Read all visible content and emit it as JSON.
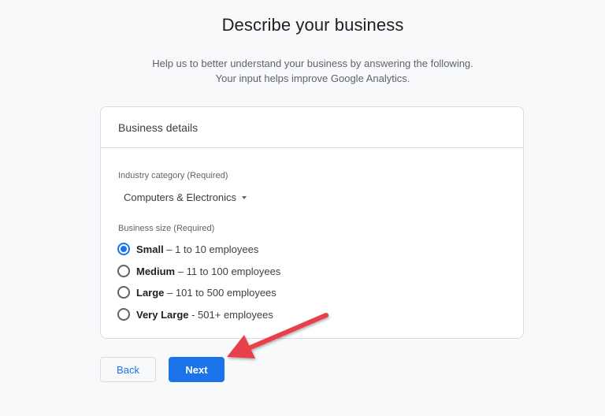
{
  "page": {
    "title": "Describe your business",
    "subtitle_line1": "Help us to better understand your business by answering the following.",
    "subtitle_line2": "Your input helps improve Google Analytics."
  },
  "card": {
    "header": "Business details",
    "industry": {
      "label": "Industry category (Required)",
      "selected": "Computers & Electronics"
    },
    "size": {
      "label": "Business size (Required)",
      "options": [
        {
          "name": "Small",
          "detail": " – 1 to 10 employees",
          "checked": true
        },
        {
          "name": "Medium",
          "detail": " – 11 to 100 employees",
          "checked": false
        },
        {
          "name": "Large",
          "detail": " – 101 to 500 employees",
          "checked": false
        },
        {
          "name": "Very Large",
          "detail": " - 501+ employees",
          "checked": false
        }
      ]
    }
  },
  "buttons": {
    "back_label": "Back",
    "next_label": "Next"
  },
  "colors": {
    "accent": "#1a73e8",
    "annotation_arrow": "#e8414b"
  },
  "icons": {
    "dropdown": "caret-down-icon",
    "annotation": "red-arrow-icon"
  }
}
